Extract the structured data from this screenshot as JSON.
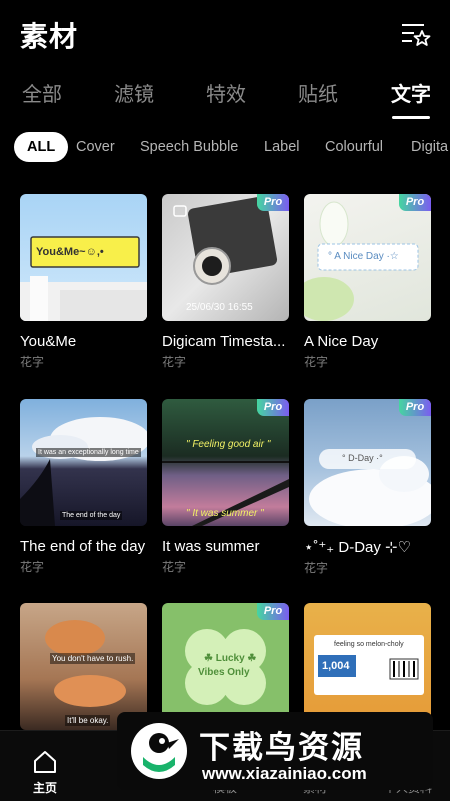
{
  "header": {
    "title": "素材",
    "filter_icon": "filter-star-icon"
  },
  "tabs": [
    {
      "label": "全部"
    },
    {
      "label": "滤镜"
    },
    {
      "label": "特效"
    },
    {
      "label": "贴纸"
    },
    {
      "label": "文字",
      "active": true
    }
  ],
  "chips": [
    "ALL",
    "Cover",
    "Speech Bubble",
    "Label",
    "Colourful",
    "Digita"
  ],
  "cards": [
    {
      "title": "You&Me",
      "subtitle": "花字",
      "pro": false,
      "thumb_text": "You&Me~☺,•"
    },
    {
      "title": "Digicam Timesta...",
      "subtitle": "花字",
      "pro": true,
      "thumb_text": "25/06/30  16:55"
    },
    {
      "title": "A Nice Day",
      "subtitle": "花字",
      "pro": true,
      "thumb_text": "° A Nice Day ·☆"
    },
    {
      "title": "The end of the day",
      "subtitle": "花字",
      "pro": false,
      "thumb_text": "It was an exceptionally long time",
      "thumb_text2": "The end of the day"
    },
    {
      "title": "It was summer",
      "subtitle": "花字",
      "pro": true,
      "thumb_text": "\" Feeling good air \"",
      "thumb_text2": "\" It was summer \""
    },
    {
      "title": "⋆˚⁺₊ D-Day ⊹♡",
      "subtitle": "花字",
      "pro": true,
      "thumb_text": "° D-Day ·°"
    },
    {
      "title": "",
      "subtitle": "",
      "pro": false,
      "thumb_text": "You don't have to rush.",
      "thumb_text2": "It'll be okay."
    },
    {
      "title": "",
      "subtitle": "",
      "pro": true,
      "thumb_text": "☘ Lucky ☘",
      "thumb_text2": "Vibes Only"
    },
    {
      "title": "",
      "subtitle": "",
      "pro": false,
      "thumb_text": "feeling so melon-choly",
      "thumb_text2": "1,004"
    }
  ],
  "pro_label": "Pro",
  "nav": [
    {
      "label": "主页",
      "icon": "home-icon",
      "active": true
    },
    {
      "label": "AI"
    },
    {
      "label": "模板"
    },
    {
      "label": "素材"
    },
    {
      "label": "个人资料"
    }
  ],
  "watermark": {
    "text": "下载鸟资源",
    "url": "www.xiazainiao.com"
  }
}
